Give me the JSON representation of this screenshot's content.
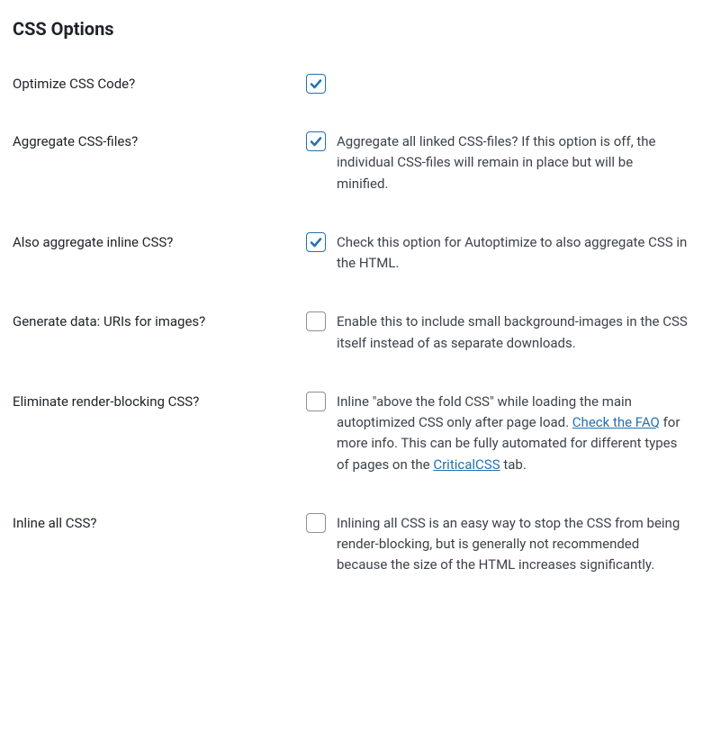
{
  "section": {
    "title": "CSS Options"
  },
  "options": {
    "optimize_css": {
      "label": "Optimize CSS Code?",
      "checked": true,
      "description": ""
    },
    "aggregate_css": {
      "label": "Aggregate CSS-files?",
      "checked": true,
      "description": "Aggregate all linked CSS-files? If this option is off, the individual CSS-files will remain in place but will be minified."
    },
    "aggregate_inline": {
      "label": "Also aggregate inline CSS?",
      "checked": true,
      "description": "Check this option for Autoptimize to also aggregate CSS in the HTML."
    },
    "data_uris": {
      "label": "Generate data: URIs for images?",
      "checked": false,
      "description": "Enable this to include small background-images in the CSS itself instead of as separate downloads."
    },
    "eliminate_render_blocking": {
      "label": "Eliminate render-blocking CSS?",
      "checked": false,
      "desc_part1": "Inline \"above the fold CSS\" while loading the main autoptimized CSS only after page load. ",
      "link1_text": "Check the FAQ",
      "desc_part2": " for more info. This can be fully automated for different types of pages on the ",
      "link2_text": "CriticalCSS",
      "desc_part3": " tab."
    },
    "inline_all": {
      "label": "Inline all CSS?",
      "checked": false,
      "description": "Inlining all CSS is an easy way to stop the CSS from being render-blocking, but is generally not recommended because the size of the HTML increases significantly."
    }
  }
}
